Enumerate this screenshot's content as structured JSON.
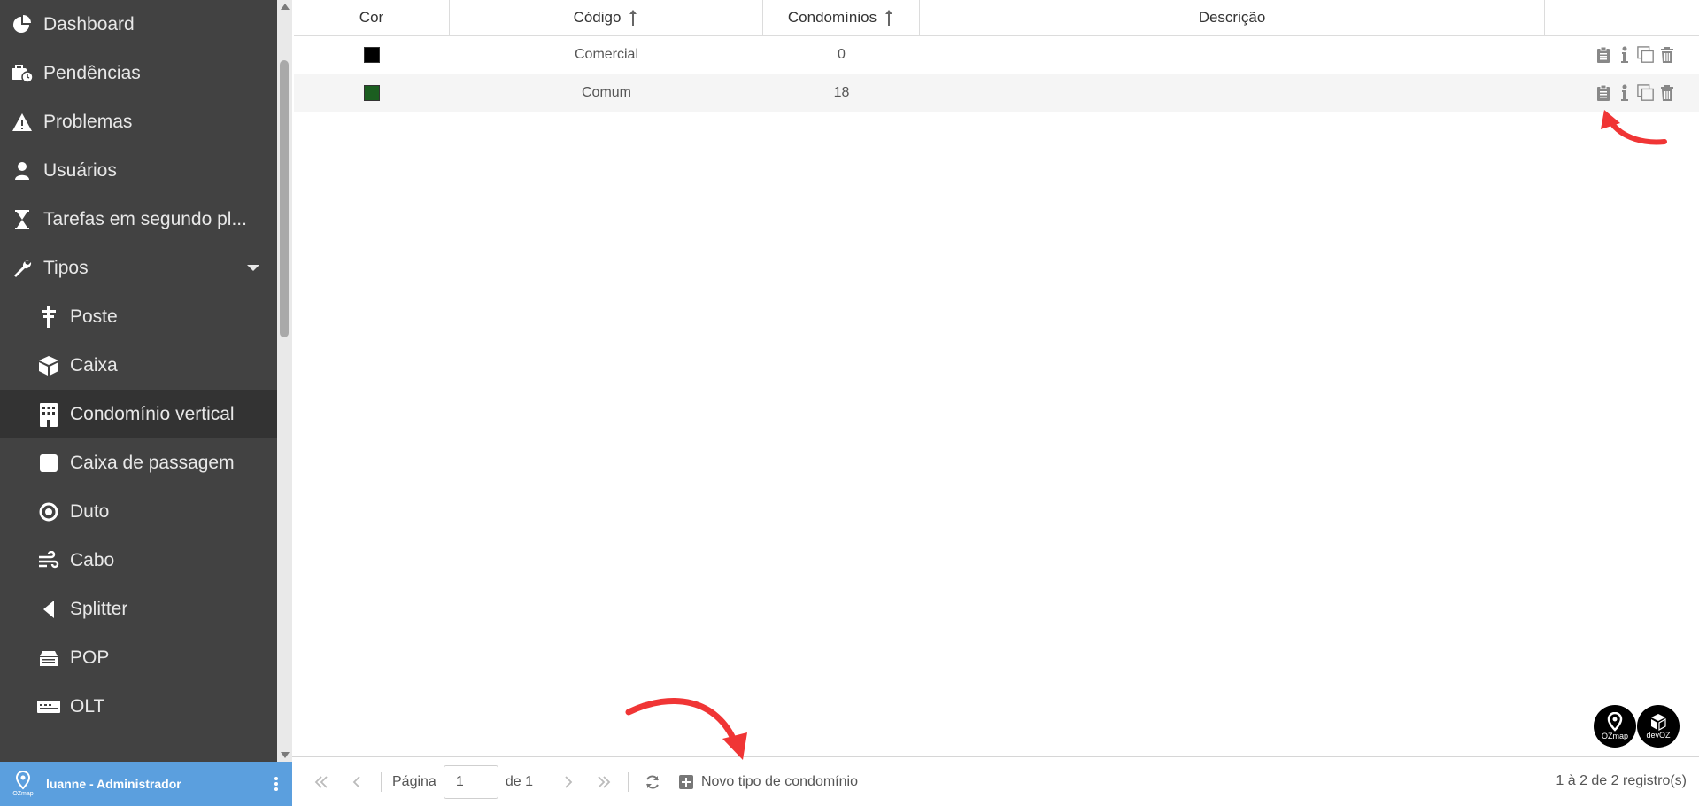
{
  "sidebar": {
    "items": [
      {
        "label": "Dashboard",
        "icon": "pie-chart-icon"
      },
      {
        "label": "Pendências",
        "icon": "briefcase-clock-icon"
      },
      {
        "label": "Problemas",
        "icon": "warning-icon"
      },
      {
        "label": "Usuários",
        "icon": "user-icon"
      },
      {
        "label": "Tarefas em segundo pl...",
        "icon": "hourglass-icon"
      },
      {
        "label": "Tipos",
        "icon": "wrench-icon"
      }
    ],
    "sub_items": [
      {
        "label": "Poste",
        "icon": "pole-icon"
      },
      {
        "label": "Caixa",
        "icon": "box-icon"
      },
      {
        "label": "Condomínio vertical",
        "icon": "building-icon"
      },
      {
        "label": "Caixa de passagem",
        "icon": "square-icon"
      },
      {
        "label": "Duto",
        "icon": "circle-dot-icon"
      },
      {
        "label": "Cabo",
        "icon": "wind-icon"
      },
      {
        "label": "Splitter",
        "icon": "triangle-left-icon"
      },
      {
        "label": "POP",
        "icon": "pop-icon"
      },
      {
        "label": "OLT",
        "icon": "olt-icon"
      }
    ],
    "active": "Condomínio vertical"
  },
  "user": {
    "name": "luanne - Administrador",
    "logo_text": "OZmap"
  },
  "table": {
    "headers": {
      "color": "Cor",
      "code": "Código",
      "condos": "Condomínios",
      "description": "Descrição"
    },
    "rows": [
      {
        "color": "#000000",
        "code": "Comercial",
        "condos": "0",
        "description": ""
      },
      {
        "color": "#1b5e20",
        "code": "Comum",
        "condos": "18",
        "description": ""
      }
    ]
  },
  "toolbar": {
    "page_label": "Página",
    "page_value": "1",
    "of_label": "de 1",
    "new_label": "Novo tipo de condomínio",
    "summary": "1 à 2 de 2 registro(s)"
  },
  "brands": {
    "ozmap": "OZmap",
    "devoz": "devOZ"
  },
  "colors": {
    "sidebar_bg": "#424242",
    "active_bg": "#333333",
    "user_bar": "#5b9fde",
    "annotation": "#f03535"
  }
}
